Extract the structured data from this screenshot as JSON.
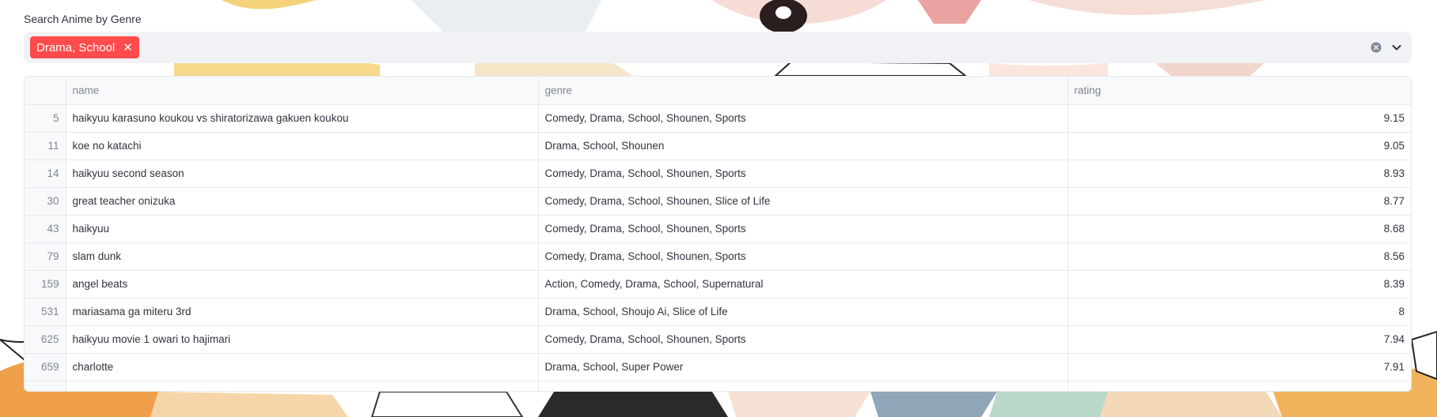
{
  "genre_search": {
    "label": "Search Anime by Genre",
    "selected": [
      "Drama, School"
    ],
    "clear_icon": "clear-circle-icon",
    "dropdown_icon": "chevron-down-icon",
    "remove_icon": "close-icon"
  },
  "theme": {
    "accent": "#ff4b4b",
    "input_bg": "#f0f2f6",
    "header_bg": "#f8f9fb",
    "border": "#e6e9ef"
  },
  "table": {
    "columns": [
      "",
      "name",
      "genre",
      "rating"
    ],
    "rows": [
      {
        "index": "5",
        "name": "haikyuu karasuno koukou vs shiratorizawa gakuen koukou",
        "genre": "Comedy, Drama, School, Shounen, Sports",
        "rating": "9.15"
      },
      {
        "index": "11",
        "name": "koe no katachi",
        "genre": "Drama, School, Shounen",
        "rating": "9.05"
      },
      {
        "index": "14",
        "name": "haikyuu second season",
        "genre": "Comedy, Drama, School, Shounen, Sports",
        "rating": "8.93"
      },
      {
        "index": "30",
        "name": "great teacher onizuka",
        "genre": "Comedy, Drama, School, Shounen, Slice of Life",
        "rating": "8.77"
      },
      {
        "index": "43",
        "name": "haikyuu",
        "genre": "Comedy, Drama, School, Shounen, Sports",
        "rating": "8.68"
      },
      {
        "index": "79",
        "name": "slam dunk",
        "genre": "Comedy, Drama, School, Shounen, Sports",
        "rating": "8.56"
      },
      {
        "index": "159",
        "name": "angel beats",
        "genre": "Action, Comedy, Drama, School, Supernatural",
        "rating": "8.39"
      },
      {
        "index": "531",
        "name": "mariasama ga miteru 3rd",
        "genre": "Drama, School, Shoujo Ai, Slice of Life",
        "rating": "8"
      },
      {
        "index": "625",
        "name": "haikyuu movie 1 owari to hajimari",
        "genre": "Comedy, Drama, School, Shounen, Sports",
        "rating": "7.94"
      },
      {
        "index": "659",
        "name": "charlotte",
        "genre": "Drama, School, Super Power",
        "rating": "7.91"
      }
    ]
  }
}
